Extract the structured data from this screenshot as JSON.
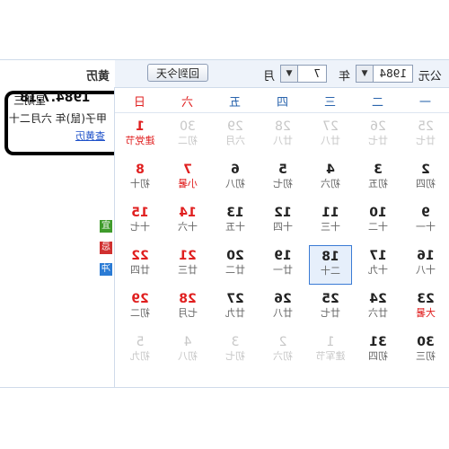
{
  "toolbar": {
    "era_label": "公元",
    "year_value": "1984",
    "year_label": "年",
    "month_value": "7",
    "month_label": "月",
    "today_button": "回到今天",
    "section_title": "黄历"
  },
  "weekdays": [
    "一",
    "二",
    "三",
    "四",
    "五",
    "六",
    "日"
  ],
  "days": [
    {
      "d": "25",
      "l": "廿七",
      "other": true
    },
    {
      "d": "26",
      "l": "廿七",
      "other": true
    },
    {
      "d": "27",
      "l": "廿八",
      "other": true
    },
    {
      "d": "28",
      "l": "廿八",
      "other": true
    },
    {
      "d": "29",
      "l": "六月",
      "other": true
    },
    {
      "d": "30",
      "l": "初二",
      "other": true
    },
    {
      "d": "1",
      "l": "建党节",
      "fest": true
    },
    {
      "d": "2",
      "l": "初四"
    },
    {
      "d": "3",
      "l": "初五"
    },
    {
      "d": "4",
      "l": "初六"
    },
    {
      "d": "5",
      "l": "初七"
    },
    {
      "d": "6",
      "l": "初八"
    },
    {
      "d": "7",
      "l": "小暑",
      "fest": true
    },
    {
      "d": "8",
      "l": "初十"
    },
    {
      "d": "9",
      "l": "十一"
    },
    {
      "d": "10",
      "l": "十二"
    },
    {
      "d": "11",
      "l": "十三"
    },
    {
      "d": "12",
      "l": "十四"
    },
    {
      "d": "13",
      "l": "十五"
    },
    {
      "d": "14",
      "l": "十六"
    },
    {
      "d": "15",
      "l": "十七"
    },
    {
      "d": "16",
      "l": "十八"
    },
    {
      "d": "17",
      "l": "十九"
    },
    {
      "d": "18",
      "l": "二十",
      "today": true
    },
    {
      "d": "19",
      "l": "廿一"
    },
    {
      "d": "20",
      "l": "廿二"
    },
    {
      "d": "21",
      "l": "廿三"
    },
    {
      "d": "22",
      "l": "廿四"
    },
    {
      "d": "23",
      "l": "大暑",
      "fest": true
    },
    {
      "d": "24",
      "l": "廿六"
    },
    {
      "d": "25",
      "l": "廿七"
    },
    {
      "d": "26",
      "l": "廿八"
    },
    {
      "d": "27",
      "l": "廿九"
    },
    {
      "d": "28",
      "l": "七月"
    },
    {
      "d": "29",
      "l": "初二"
    },
    {
      "d": "30",
      "l": "初三"
    },
    {
      "d": "31",
      "l": "初四"
    },
    {
      "d": "1",
      "l": "建军节",
      "other": true
    },
    {
      "d": "2",
      "l": "初六",
      "other": true
    },
    {
      "d": "3",
      "l": "初七",
      "other": true
    },
    {
      "d": "4",
      "l": "初八",
      "other": true
    },
    {
      "d": "5",
      "l": "初九",
      "other": true
    }
  ],
  "info": {
    "date": "1984.7.18",
    "weekday": "星期三",
    "ganzhi": "甲子(鼠)年 六月二十",
    "more_link": "查黄历",
    "tag_yi": "宜",
    "tag_ji": "忌",
    "tag_zhong": "冲"
  },
  "colors": {
    "weekend": "#e01f1f",
    "weekday_header": "#2a64ad",
    "today_border": "#3a7bd5",
    "yi_tag": "#3f9b2b",
    "ji_tag": "#d03030",
    "zhong_tag": "#2a7bd5"
  }
}
